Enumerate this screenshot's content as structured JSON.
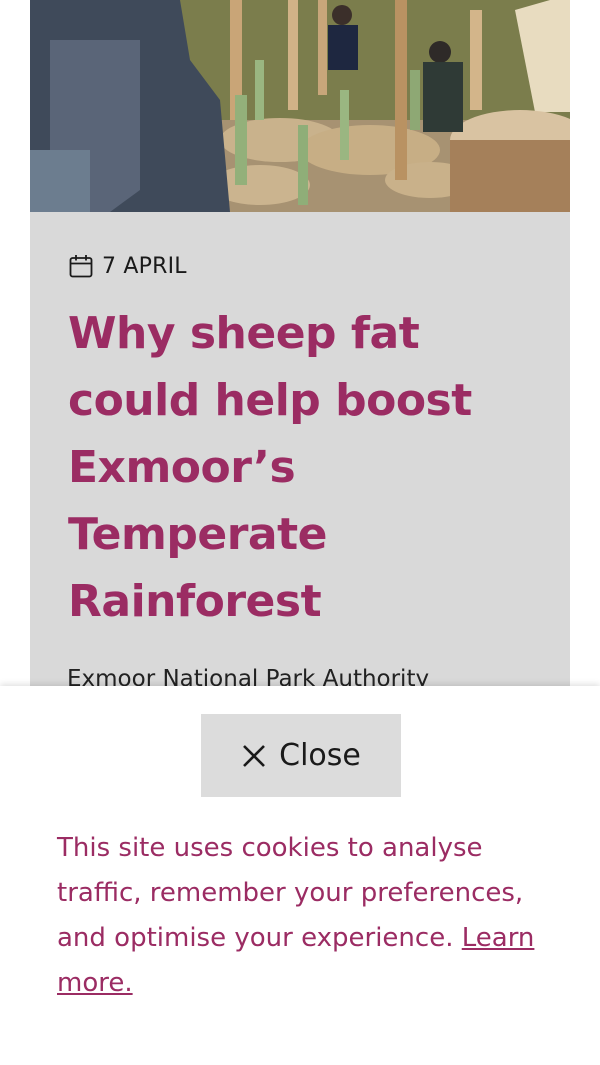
{
  "article": {
    "date": "7 APRIL",
    "title": "Why sheep fat could help boost Exmoor’s Temperate Rainforest",
    "teaser": "Exmoor National Park Authority"
  },
  "cookie_banner": {
    "close_label": "Close",
    "message": "This site uses cookies to analyse traffic, remember your preferences, and optimise your experience.",
    "link_label": "Learn more."
  },
  "colors": {
    "accent": "#9b2c63",
    "card_bg": "#d9d9d9",
    "button_bg": "#dcdcdc"
  },
  "icons": {
    "date": "calendar-icon",
    "close": "close-icon"
  }
}
